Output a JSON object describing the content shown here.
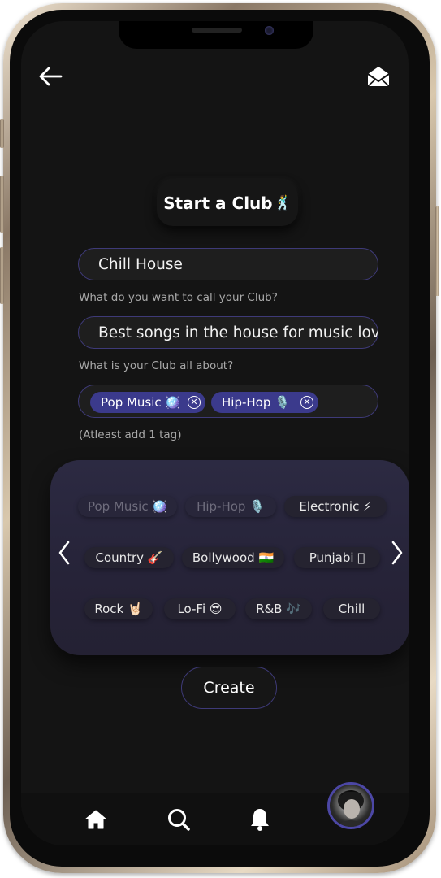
{
  "header": {
    "back_icon": "arrow-left-icon",
    "mail_icon": "envelope-open-icon"
  },
  "title": {
    "text": "Start a Club",
    "emoji": "🕺"
  },
  "club_name": {
    "value": "Chill House",
    "hint": "What do you want to call your Club?"
  },
  "club_about": {
    "value": "Best songs in the house for music lovers",
    "hint": "What is your Club all about?"
  },
  "selected_tags": [
    {
      "label": "Pop Music 🪩"
    },
    {
      "label": "Hip-Hop 🎙️"
    }
  ],
  "tags_hint": "(Atleast add  1 tag)",
  "genres": [
    {
      "label": "Pop Music 🪩",
      "state": "selected"
    },
    {
      "label": "Hip-Hop 🎙️",
      "state": "selected"
    },
    {
      "label": "Electronic ⚡",
      "state": "available"
    },
    {
      "label": "Country 🎸",
      "state": "available"
    },
    {
      "label": "Bollywood 🇮🇳",
      "state": "available"
    },
    {
      "label": "Punjabi 🏻",
      "state": "available"
    },
    {
      "label": "Rock 🤘🏻",
      "state": "available"
    },
    {
      "label": "Lo-Fi 😎",
      "state": "available"
    },
    {
      "label": "R&B 🎶",
      "state": "available"
    },
    {
      "label": "Chill",
      "state": "available"
    }
  ],
  "create_button": "Create",
  "bottom_nav": {
    "items": [
      "home-icon",
      "search-icon",
      "bell-icon",
      "profile-avatar"
    ]
  },
  "colors": {
    "accent": "#3b3a8c",
    "border": "#3e3a78",
    "background": "#141414"
  }
}
